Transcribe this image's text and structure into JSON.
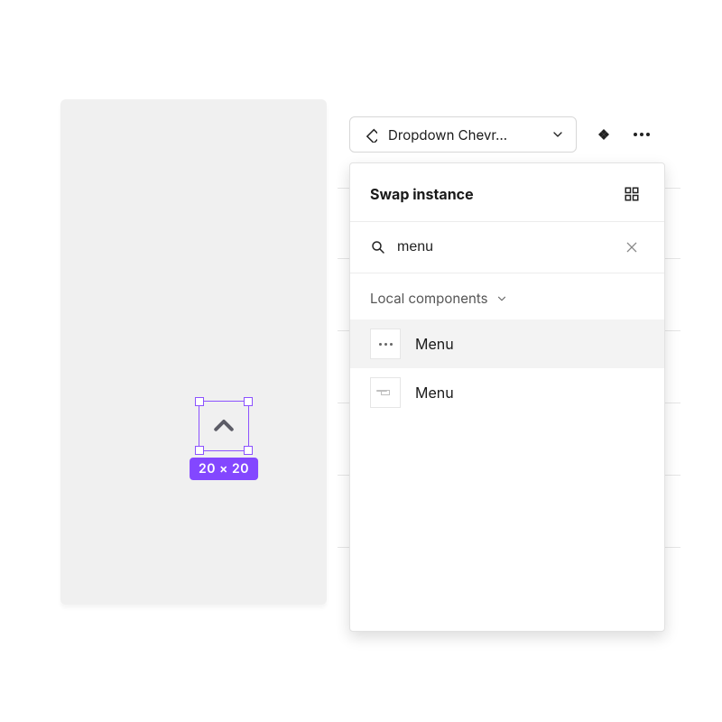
{
  "canvas": {
    "selection_dimensions": "20 × 20"
  },
  "topbar": {
    "instance_label": "Dropdown Chevr…"
  },
  "panel": {
    "title": "Swap instance",
    "search_value": "menu",
    "section_label": "Local components",
    "results": [
      {
        "label": "Menu"
      },
      {
        "label": "Menu"
      }
    ]
  }
}
